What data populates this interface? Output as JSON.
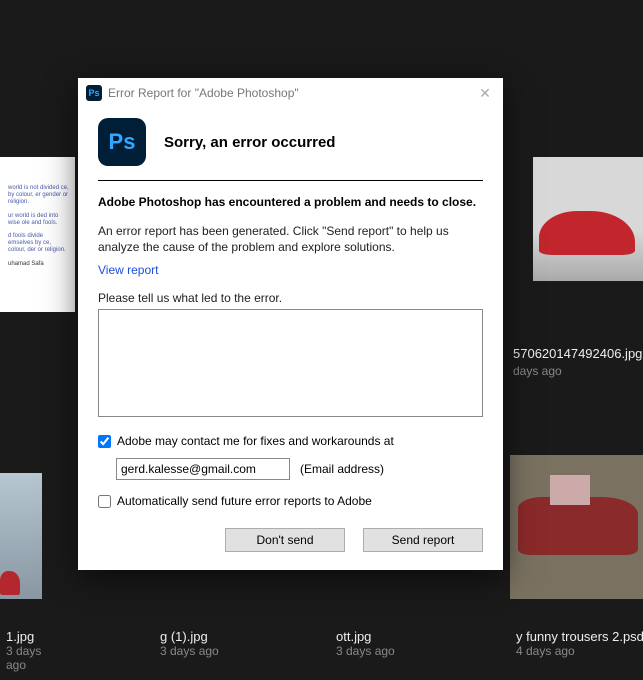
{
  "dialog": {
    "title": "Error Report for \"Adobe Photoshop\"",
    "heading": "Sorry, an error occurred",
    "boldLine": "Adobe Photoshop has encountered a problem and needs to close.",
    "description": "An error report has been generated. Click \"Send report\" to help us analyze the cause of the problem and explore solutions.",
    "viewReport": "View report",
    "prompt": "Please tell us what led to the error.",
    "textareaValue": "",
    "contactLabel": "Adobe may contact me for fixes and workarounds at",
    "contactChecked": true,
    "email": "gerd.kalesse@gmail.com",
    "emailHint": "(Email address)",
    "autoSendLabel": "Automatically send future error reports to Adobe",
    "autoSendChecked": false,
    "dontSend": "Don't send",
    "sendReport": "Send report"
  },
  "bg": {
    "topRightFile": "570620147492406.jpg",
    "topRightAgo": "days ago",
    "files": [
      {
        "name": "1.jpg",
        "ago": "3 days ago"
      },
      {
        "name": "g (1).jpg",
        "ago": "3 days ago"
      },
      {
        "name": "ott.jpg",
        "ago": "3 days ago"
      },
      {
        "name": "y funny trousers 2.psd",
        "ago": "4 days ago"
      }
    ]
  }
}
